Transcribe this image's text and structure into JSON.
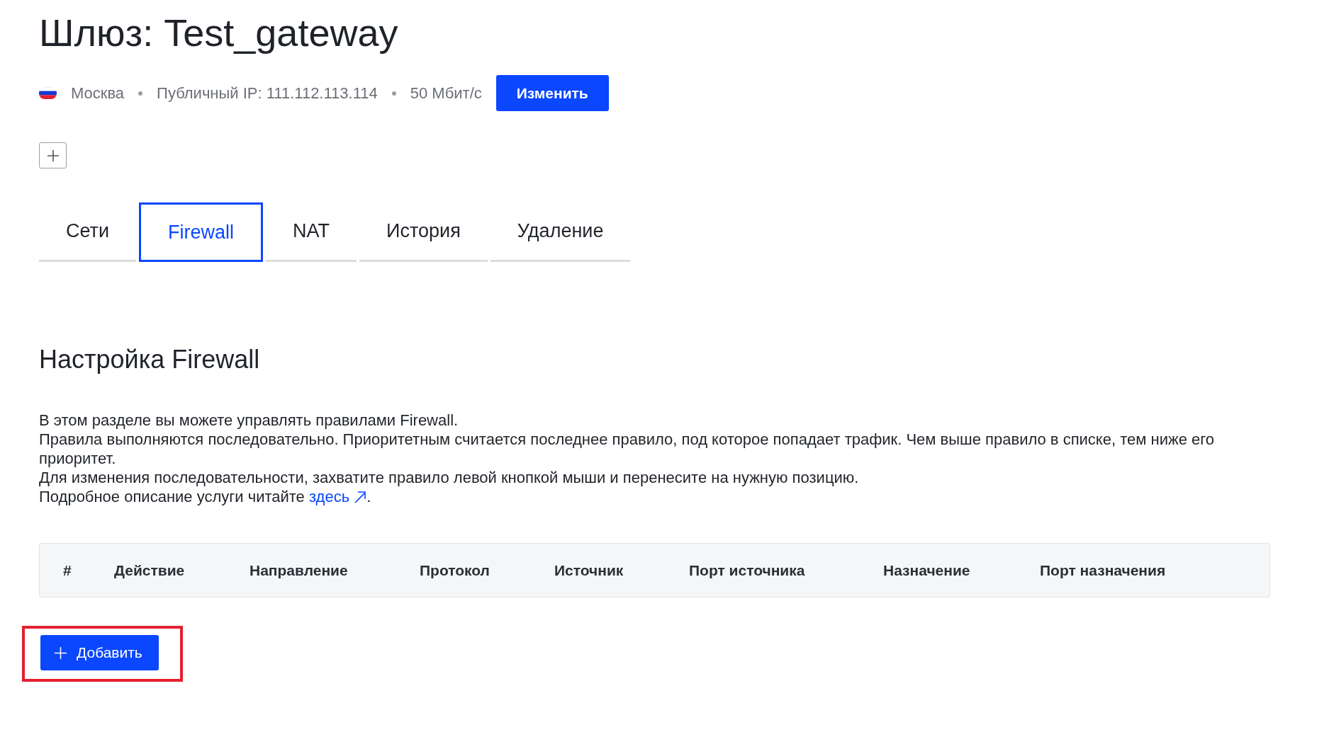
{
  "title": "Шлюз: Test_gateway",
  "info": {
    "location": "Москва",
    "ip": "Публичный IP: 111.112.113.114",
    "speed": "50 Мбит/с",
    "edit_button": "Изменить"
  },
  "tabs": [
    {
      "label": "Сети",
      "selected": false
    },
    {
      "label": "Firewall",
      "selected": true
    },
    {
      "label": "NAT",
      "selected": false
    },
    {
      "label": "История",
      "selected": false
    },
    {
      "label": "Удаление",
      "selected": false
    }
  ],
  "section": {
    "heading": "Настройка Firewall",
    "lines": [
      "В этом разделе вы можете управлять правилами Firewall.",
      "Правила выполняются последовательно. Приоритетным считается последнее правило, под которое попадает трафик. Чем выше правило в списке, тем ниже его приоритет.",
      "Для изменения последовательности, захватите правило левой кнопкой мыши и перенесите на нужную позицию."
    ],
    "more_text": "Подробное описание услуги читайте ",
    "more_link": "здесь",
    "more_end": "."
  },
  "table": {
    "columns": [
      "#",
      "Действие",
      "Направление",
      "Протокол",
      "Источник",
      "Порт источника",
      "Назначение",
      "Порт назначения"
    ]
  },
  "add_button": {
    "label": "Добавить",
    "highlighted": true
  }
}
